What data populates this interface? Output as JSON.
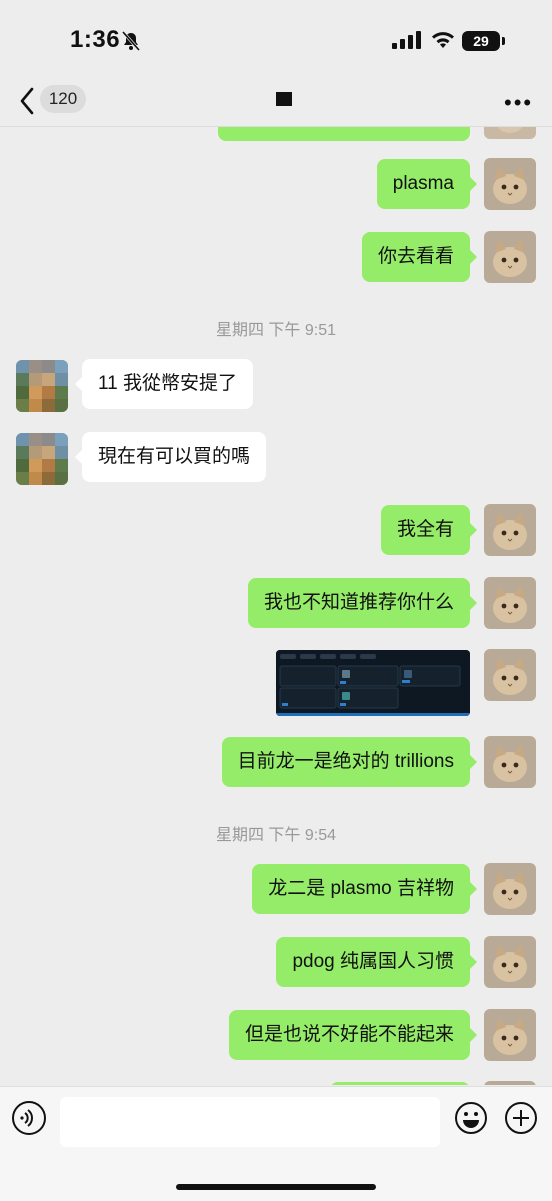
{
  "status": {
    "time": "1:36",
    "battery": "29"
  },
  "nav": {
    "unread": "120",
    "title": ""
  },
  "messages": [
    {
      "text": "plasma"
    },
    {
      "text": "你去看看"
    },
    {
      "timestamp": "星期四 下午 9:51"
    },
    {
      "text": "11 我從幣安提了"
    },
    {
      "text": "現在有可以買的嗎"
    },
    {
      "text": "我全有"
    },
    {
      "text": "我也不知道推荐你什么"
    },
    {
      "text": "目前龙一是绝对的 trillions"
    },
    {
      "timestamp": "星期四 下午 9:54"
    },
    {
      "text": "龙二是 plasmo 吉祥物"
    },
    {
      "text": "pdog 纯属国人习惯"
    },
    {
      "text": "但是也说不好能不能起来"
    }
  ],
  "colors": {
    "bubble_me": "#95ec69",
    "bubble_them": "#ffffff",
    "background": "#ededed"
  }
}
